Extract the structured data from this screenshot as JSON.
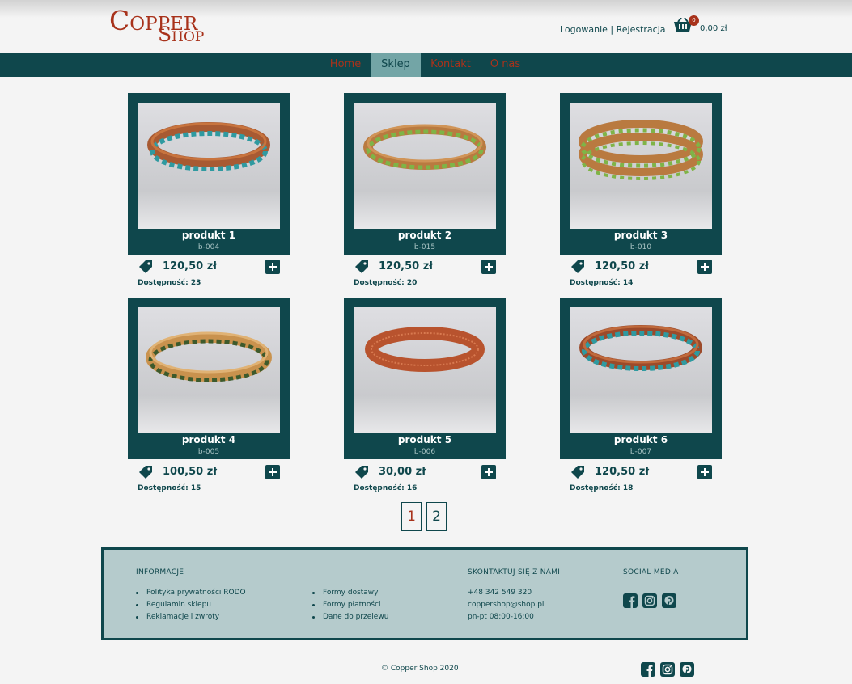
{
  "header": {
    "logo_line1": "Copper",
    "logo_line2": "Shop",
    "login": "Logowanie",
    "separator": " | ",
    "register": "Rejestracja",
    "cart_count": "0",
    "cart_total": "0,00 zł",
    "icons": {
      "cart": "basket-icon"
    }
  },
  "nav": {
    "items": [
      {
        "label": "Home"
      },
      {
        "label": "Sklep"
      },
      {
        "label": "Kontakt"
      },
      {
        "label": "O nas"
      }
    ],
    "active": "Sklep"
  },
  "products": [
    {
      "name": "produkt 1",
      "code": "b-004",
      "price": "120,50 zł",
      "availability": "Dostępność: 23"
    },
    {
      "name": "produkt 2",
      "code": "b-015",
      "price": "120,50 zł",
      "availability": "Dostępność: 20"
    },
    {
      "name": "produkt 3",
      "code": "b-010",
      "price": "120,50 zł",
      "availability": "Dostępność: 14"
    },
    {
      "name": "produkt 4",
      "code": "b-005",
      "price": "100,50 zł",
      "availability": "Dostępność: 15"
    },
    {
      "name": "produkt 5",
      "code": "b-006",
      "price": "30,00 zł",
      "availability": "Dostępność: 16"
    },
    {
      "name": "produkt 6",
      "code": "b-007",
      "price": "120,50 zł",
      "availability": "Dostępność: 18"
    }
  ],
  "pagination": {
    "pages": [
      "1",
      "2"
    ],
    "current": "1"
  },
  "footer": {
    "info_heading": "INFORMACJE",
    "info_col1": [
      "Polityka prywatności RODO",
      "Regulamin sklepu",
      "Reklamacje i zwroty"
    ],
    "info_col2": [
      "Formy dostawy",
      "Formy płatności",
      "Dane do przelewu"
    ],
    "contact_heading": "SKONTAKTUJ SIĘ Z NAMI",
    "contact": [
      "+48 342 549 320",
      "coppershop@shop.pl",
      "pn-pt 08:00-16:00"
    ],
    "social_heading": "SOCIAL MEDIA",
    "social_icons": [
      "facebook-icon",
      "instagram-icon",
      "pinterest-icon"
    ],
    "copyright": "© Copper Shop 2020"
  },
  "colors": {
    "primary": "#0f474c",
    "accent": "#a8321b",
    "nav_active": "#73a5a6",
    "footer_bg": "#b5cbcc",
    "page_bg": "#f4f4f4"
  }
}
